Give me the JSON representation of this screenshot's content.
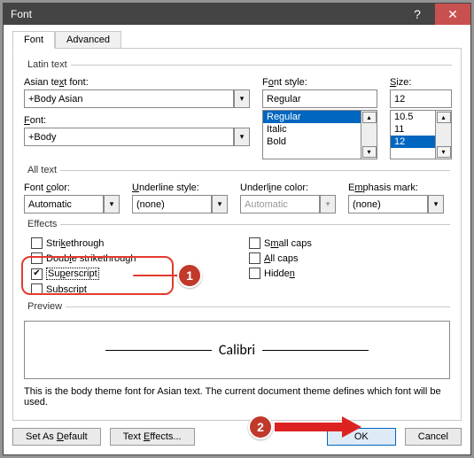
{
  "window": {
    "title": "Font",
    "help": "?",
    "close": "✕"
  },
  "tabs": {
    "font": "Font",
    "advanced": "Advanced"
  },
  "latin": {
    "legend": "Latin text",
    "asianFontLabelPre": "Asian te",
    "asianFontKey": "x",
    "asianFontLabelPost": "t font:",
    "asianFontValue": "+Body Asian",
    "fontLabelKey": "F",
    "fontLabelPost": "ont:",
    "fontValue": "+Body",
    "fontStyleLabelPre": "F",
    "fontStyleKey": "o",
    "fontStyleLabelPost": "nt style:",
    "fontStyleValue": "Regular",
    "fontStyleItems": [
      "Regular",
      "Italic",
      "Bold"
    ],
    "sizeLabelKey": "S",
    "sizeLabelPost": "ize:",
    "sizeValue": "12",
    "sizeItems": [
      "10.5",
      "11",
      "12"
    ]
  },
  "all": {
    "legend": "All text",
    "fontColorLabelPre": "Font ",
    "fontColorKey": "c",
    "fontColorLabelPost": "olor:",
    "fontColorValue": "Automatic",
    "underlineStyleLabelKey": "U",
    "underlineStyleLabelPost": "nderline style:",
    "underlineStyleValue": "(none)",
    "underlineColorLabelPre": "Underl",
    "underlineColorKey": "i",
    "underlineColorLabelPost": "ne color:",
    "underlineColorValue": "Automatic",
    "emphasisLabelPre": "E",
    "emphasisKey": "m",
    "emphasisLabelPost": "phasis mark:",
    "emphasisValue": "(none)"
  },
  "effects": {
    "legend": "Effects",
    "strike": "Strikethrough",
    "strikeKey": "k",
    "dblPre": "Doub",
    "dblKey": "l",
    "dblPost": "e strikethrough",
    "supPre": "Su",
    "supKey": "p",
    "supPost": "erscript",
    "subPre": "Su",
    "subKey": "b",
    "subPost": "script",
    "smallPre": "S",
    "smallKey": "m",
    "smallPost": "all caps",
    "allKey": "A",
    "allPost": "ll caps",
    "hiddenPre": "Hidde",
    "hiddenKey": "n"
  },
  "preview": {
    "legend": "Preview",
    "text": "Calibri"
  },
  "desc": "This is the body theme font for Asian text. The current document theme defines which font will be used.",
  "buttons": {
    "setDefaultPre": "Set As ",
    "setDefaultKey": "D",
    "setDefaultPost": "efault",
    "textEffectsPre": "Text ",
    "textEffectsKey": "E",
    "textEffectsPost": "ffects...",
    "ok": "OK",
    "cancel": "Cancel"
  },
  "ann": {
    "b1": "1",
    "b2": "2"
  }
}
